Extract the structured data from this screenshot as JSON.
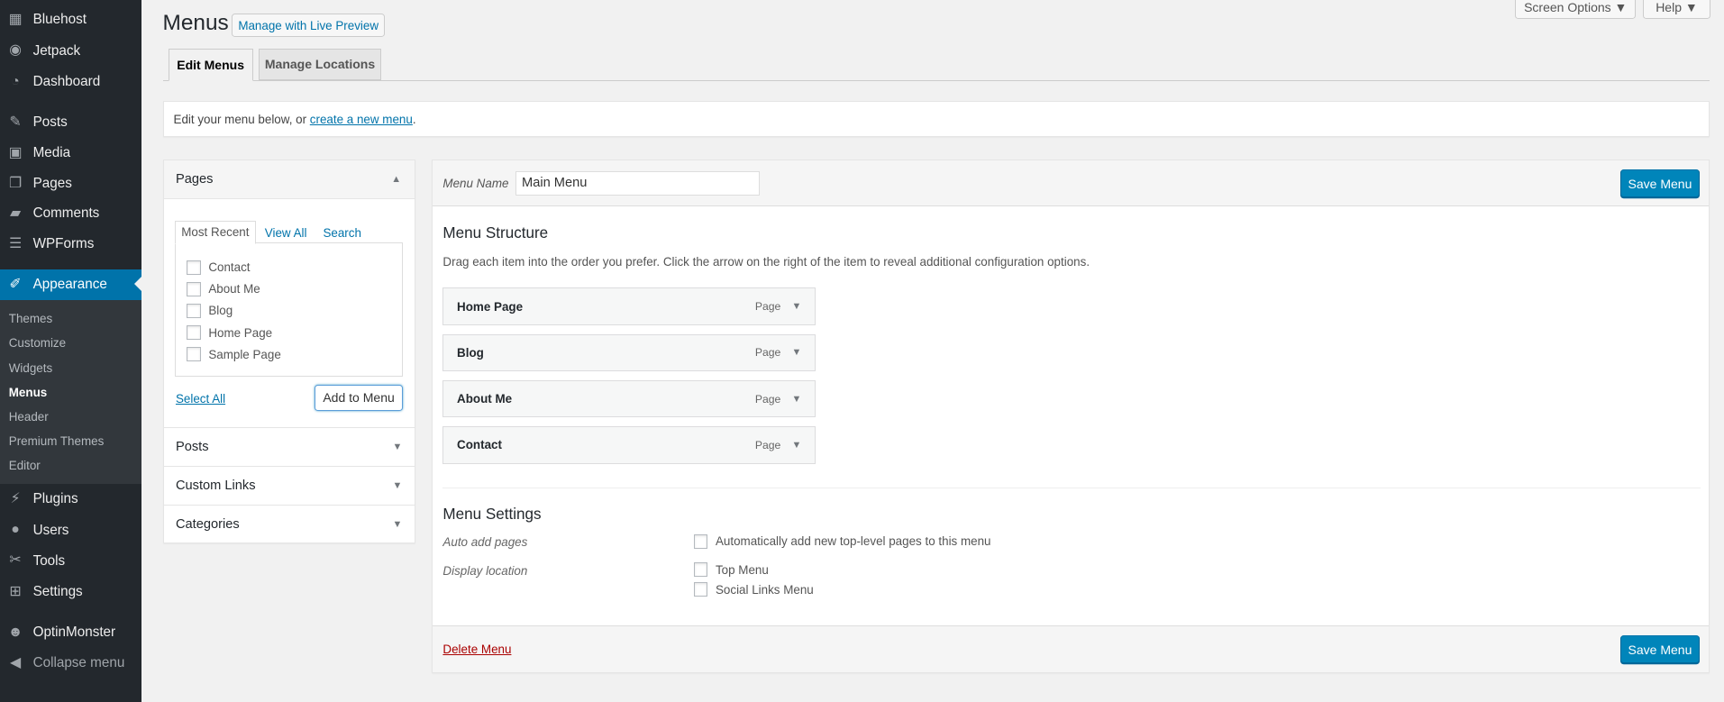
{
  "sidebar": {
    "items": [
      {
        "label": "Bluehost",
        "icon": "grid-icon"
      },
      {
        "label": "Jetpack",
        "icon": "jetpack-icon"
      },
      {
        "label": "Dashboard",
        "icon": "dashboard-icon"
      },
      {
        "label": "Posts",
        "icon": "pin-icon"
      },
      {
        "label": "Media",
        "icon": "media-icon"
      },
      {
        "label": "Pages",
        "icon": "pages-icon"
      },
      {
        "label": "Comments",
        "icon": "comment-icon"
      },
      {
        "label": "WPForms",
        "icon": "forms-icon"
      },
      {
        "label": "Appearance",
        "icon": "brush-icon"
      },
      {
        "label": "Plugins",
        "icon": "plugin-icon"
      },
      {
        "label": "Users",
        "icon": "user-icon"
      },
      {
        "label": "Tools",
        "icon": "wrench-icon"
      },
      {
        "label": "Settings",
        "icon": "settings-icon"
      },
      {
        "label": "OptinMonster",
        "icon": "monster-icon"
      },
      {
        "label": "Collapse menu",
        "icon": "collapse-icon"
      }
    ],
    "submenu": [
      "Themes",
      "Customize",
      "Widgets",
      "Menus",
      "Header",
      "Premium Themes",
      "Editor"
    ],
    "current_submenu": "Menus"
  },
  "header": {
    "title": "Menus",
    "live_preview": "Manage with Live Preview",
    "screen_options": "Screen Options ▼",
    "help": "Help ▼"
  },
  "tabs": [
    "Edit Menus",
    "Manage Locations"
  ],
  "notice": {
    "text": "Edit your menu below, or ",
    "link": "create a new menu",
    "end": "."
  },
  "left": {
    "pages_title": "Pages",
    "subtabs": [
      "Most Recent",
      "View All",
      "Search"
    ],
    "pages": [
      "Contact",
      "About Me",
      "Blog",
      "Home Page",
      "Sample Page"
    ],
    "select_all": "Select All",
    "add_to_menu": "Add to Menu",
    "sections": [
      "Posts",
      "Custom Links",
      "Categories"
    ]
  },
  "menu": {
    "name_label": "Menu Name",
    "name_value": "Main Menu",
    "save": "Save Menu",
    "structure_title": "Menu Structure",
    "structure_desc": "Drag each item into the order you prefer. Click the arrow on the right of the item to reveal additional configuration options.",
    "items": [
      {
        "title": "Home Page",
        "type": "Page"
      },
      {
        "title": "Blog",
        "type": "Page"
      },
      {
        "title": "About Me",
        "type": "Page"
      },
      {
        "title": "Contact",
        "type": "Page"
      }
    ],
    "settings_title": "Menu Settings",
    "auto_add_label": "Auto add pages",
    "auto_add_option": "Automatically add new top-level pages to this menu",
    "display_label": "Display location",
    "locations": [
      "Top Menu",
      "Social Links Menu"
    ],
    "delete": "Delete Menu"
  },
  "colors": {
    "sidebar": "#23282d",
    "accent": "#0073aa",
    "primary_button": "#0085ba",
    "delete": "#a00"
  }
}
